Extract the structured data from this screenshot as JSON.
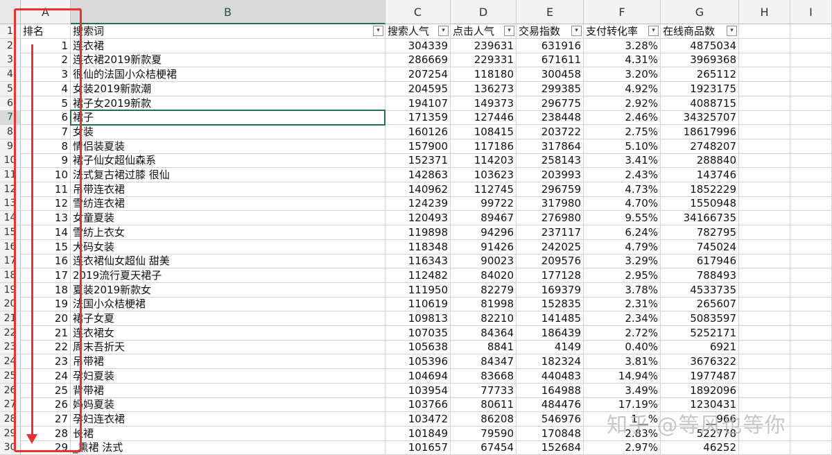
{
  "columns": [
    "A",
    "B",
    "C",
    "D",
    "E",
    "F",
    "G",
    "H",
    "I"
  ],
  "selected_column": "B",
  "header_row": {
    "rank": "排名",
    "keyword": "搜索词",
    "search_users": "搜索人气",
    "click_users": "点击人气",
    "trade_index": "交易指数",
    "pay_conv_rate": "支付转化率",
    "online_products": "在线商品数"
  },
  "filter_icon": "filter-dropdown-icon",
  "filter_symbol": "▾",
  "rows": [
    {
      "rank": "1",
      "keyword": "连衣裙",
      "search": "304339",
      "click": "239631",
      "trade": "631916",
      "rate": "3.28%",
      "products": "4875034"
    },
    {
      "rank": "2",
      "keyword": "连衣裙2019新款夏",
      "search": "286669",
      "click": "229331",
      "trade": "671611",
      "rate": "4.31%",
      "products": "3969368"
    },
    {
      "rank": "3",
      "keyword": "很仙的法国小众桔梗裙",
      "search": "207254",
      "click": "118180",
      "trade": "300458",
      "rate": "3.20%",
      "products": "265112"
    },
    {
      "rank": "4",
      "keyword": "女装2019新款潮",
      "search": "204595",
      "click": "136273",
      "trade": "299385",
      "rate": "4.92%",
      "products": "1923175"
    },
    {
      "rank": "5",
      "keyword": "裙子女2019新款",
      "search": "194107",
      "click": "149373",
      "trade": "296775",
      "rate": "2.92%",
      "products": "4088715"
    },
    {
      "rank": "6",
      "keyword": "裙子",
      "search": "171359",
      "click": "127446",
      "trade": "238448",
      "rate": "2.46%",
      "products": "34325707"
    },
    {
      "rank": "7",
      "keyword": "女装",
      "search": "160126",
      "click": "108415",
      "trade": "203722",
      "rate": "2.75%",
      "products": "18617996"
    },
    {
      "rank": "8",
      "keyword": "情侣装夏装",
      "search": "157900",
      "click": "117186",
      "trade": "317864",
      "rate": "5.10%",
      "products": "2748207"
    },
    {
      "rank": "9",
      "keyword": "裙子仙女超仙森系",
      "search": "152371",
      "click": "114203",
      "trade": "258143",
      "rate": "3.41%",
      "products": "288840"
    },
    {
      "rank": "10",
      "keyword": "法式复古裙过膝 很仙",
      "search": "142863",
      "click": "103623",
      "trade": "203993",
      "rate": "2.43%",
      "products": "143746"
    },
    {
      "rank": "11",
      "keyword": "吊带连衣裙",
      "search": "140962",
      "click": "112745",
      "trade": "296759",
      "rate": "4.73%",
      "products": "1852229"
    },
    {
      "rank": "12",
      "keyword": "雪纺连衣裙",
      "search": "124239",
      "click": "99722",
      "trade": "317980",
      "rate": "4.70%",
      "products": "1550948"
    },
    {
      "rank": "13",
      "keyword": "女童夏装",
      "search": "120493",
      "click": "89467",
      "trade": "276980",
      "rate": "9.55%",
      "products": "34166735"
    },
    {
      "rank": "14",
      "keyword": "雪纺上衣女",
      "search": "119898",
      "click": "94296",
      "trade": "237117",
      "rate": "6.24%",
      "products": "782795"
    },
    {
      "rank": "15",
      "keyword": "大码女装",
      "search": "118348",
      "click": "91426",
      "trade": "242025",
      "rate": "4.79%",
      "products": "745024"
    },
    {
      "rank": "16",
      "keyword": "连衣裙仙女超仙 甜美",
      "search": "116343",
      "click": "90023",
      "trade": "209576",
      "rate": "3.29%",
      "products": "617946"
    },
    {
      "rank": "17",
      "keyword": "2019流行夏天裙子",
      "search": "112482",
      "click": "84020",
      "trade": "177128",
      "rate": "2.95%",
      "products": "788493"
    },
    {
      "rank": "18",
      "keyword": "夏装2019新款女",
      "search": "111950",
      "click": "82279",
      "trade": "169379",
      "rate": "3.78%",
      "products": "4533735"
    },
    {
      "rank": "19",
      "keyword": "法国小众桔梗裙",
      "search": "110619",
      "click": "81998",
      "trade": "152835",
      "rate": "2.31%",
      "products": "265607"
    },
    {
      "rank": "20",
      "keyword": "裙子女夏",
      "search": "109813",
      "click": "82210",
      "trade": "141485",
      "rate": "2.34%",
      "products": "5083597"
    },
    {
      "rank": "21",
      "keyword": "连衣裙女",
      "search": "107035",
      "click": "84364",
      "trade": "186439",
      "rate": "2.72%",
      "products": "5252171"
    },
    {
      "rank": "22",
      "keyword": "周末吾折天",
      "search": "105638",
      "click": "8841",
      "trade": "4149",
      "rate": "0.40%",
      "products": "6921"
    },
    {
      "rank": "23",
      "keyword": "吊带裙",
      "search": "105396",
      "click": "84347",
      "trade": "182324",
      "rate": "3.81%",
      "products": "3676322"
    },
    {
      "rank": "24",
      "keyword": "孕妇夏装",
      "search": "104694",
      "click": "83668",
      "trade": "440483",
      "rate": "14.94%",
      "products": "1977487"
    },
    {
      "rank": "25",
      "keyword": "背带裙",
      "search": "103954",
      "click": "77733",
      "trade": "164988",
      "rate": "3.49%",
      "products": "1892096"
    },
    {
      "rank": "26",
      "keyword": "妈妈夏装",
      "search": "103766",
      "click": "80611",
      "trade": "484476",
      "rate": "17.19%",
      "products": "1230431"
    },
    {
      "rank": "27",
      "keyword": "孕妇连衣裙",
      "search": "103472",
      "click": "86208",
      "trade": "546976",
      "rate": "1__%",
      "products": "__966"
    },
    {
      "rank": "28",
      "keyword": "长裙",
      "search": "101849",
      "click": "79590",
      "trade": "170848",
      "rate": "2.83%",
      "products": "522778"
    },
    {
      "rank": "29",
      "keyword": "_熏裙 法式",
      "search": "101657",
      "click": "67454",
      "trade": "152684",
      "rate": "2.97%",
      "products": "46252"
    }
  ],
  "active_cell": {
    "row": 7,
    "column": "B"
  },
  "annotation_color": "#e63232",
  "watermark": "知乎 @等风也等你"
}
